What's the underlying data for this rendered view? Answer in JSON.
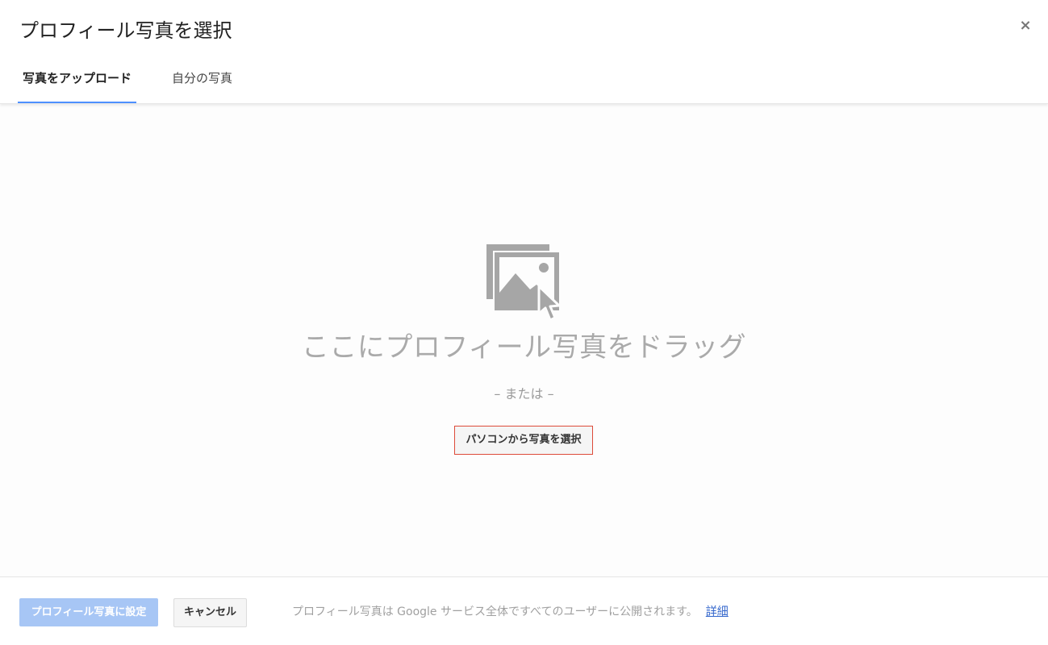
{
  "dialog": {
    "title": "プロフィール写真を選択",
    "close_label": "×"
  },
  "tabs": [
    {
      "label": "写真をアップロード",
      "active": true
    },
    {
      "label": "自分の写真",
      "active": false
    }
  ],
  "dropzone": {
    "icon": "image-drag-icon",
    "drag_text": "ここにプロフィール写真をドラッグ",
    "or_text": "– または –",
    "select_button": "パソコンから写真を選択"
  },
  "footer": {
    "set_button": "プロフィール写真に設定",
    "cancel_button": "キャンセル",
    "note": "プロフィール写真は Google サービス全体ですべてのユーザーに公開されます。",
    "link": "詳細"
  },
  "colors": {
    "accent": "#4d90fe",
    "primary_disabled": "#a7c6f5",
    "highlight_border": "#dd4b39",
    "link": "#3366cc",
    "icon_gray": "#a6a6a6"
  }
}
